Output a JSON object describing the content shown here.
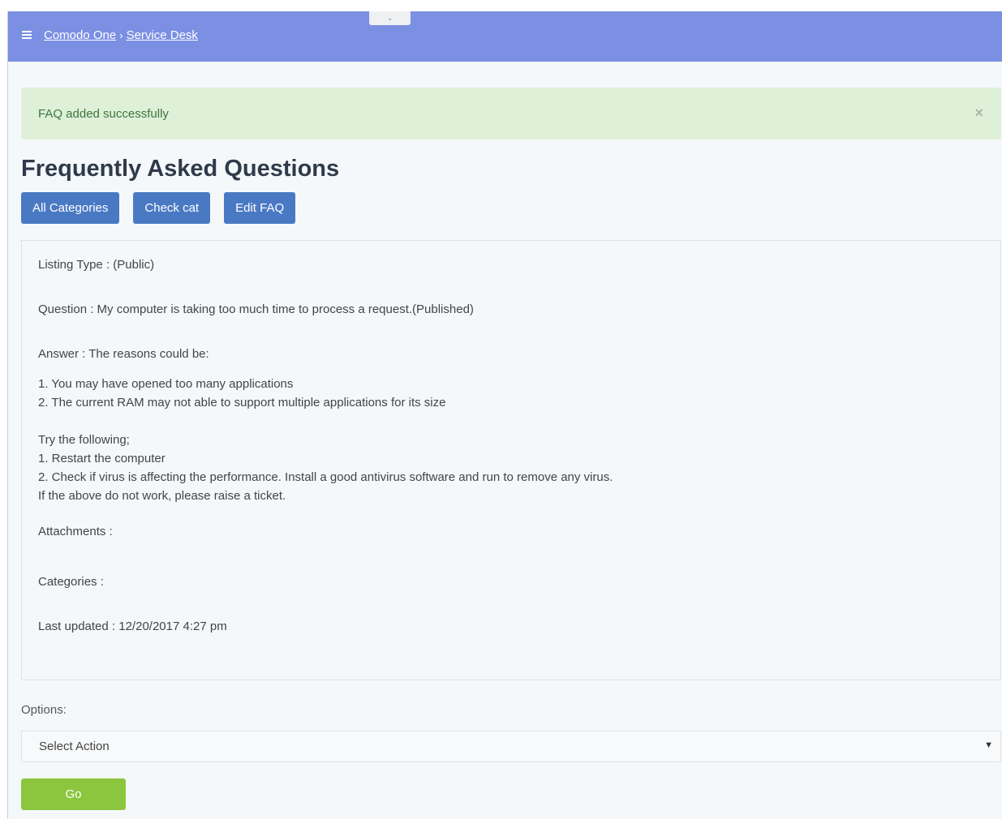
{
  "header": {
    "breadcrumb": [
      "Comodo One",
      "Service Desk"
    ],
    "separator": "›",
    "pull_tab_glyph": "⌄"
  },
  "alert": {
    "message": "FAQ added successfully",
    "close_glyph": "×"
  },
  "page_title": "Frequently Asked Questions",
  "buttons": [
    "All Categories",
    "Check cat",
    "Edit FAQ"
  ],
  "faq": {
    "listing_type": "Listing Type : (Public)",
    "question": "Question : My computer is taking too much time to process a request.(Published)",
    "answer_intro": "Answer : The reasons could be:",
    "reason_1": "1. You may have opened too many applications",
    "reason_2": "2. The current RAM may not able to support multiple applications for its size",
    "try_intro": "Try the following;",
    "step_1": "1. Restart the computer",
    "step_2": "2. Check if virus is affecting the performance. Install a good antivirus software and run to remove any virus.",
    "fallback": "If the above do not work, please raise a ticket.",
    "attachments": "Attachments :",
    "categories": "Categories :",
    "last_updated": "Last updated : 12/20/2017 4:27 pm"
  },
  "options": {
    "label": "Options:",
    "selected": "Select Action",
    "arrow_glyph": "▼",
    "go_label": "Go"
  },
  "colors": {
    "header_bg": "#7b8fe3",
    "alert_bg": "#dff0d8",
    "button_blue": "#4a79c4",
    "go_green": "#8cc63f"
  },
  "icons": {
    "menu": "hamburger-icon",
    "breadcrumb_separator": "chevron-right-icon",
    "close": "close-icon",
    "dropdown": "caret-down-icon",
    "pull_tab": "chevron-down-icon"
  }
}
